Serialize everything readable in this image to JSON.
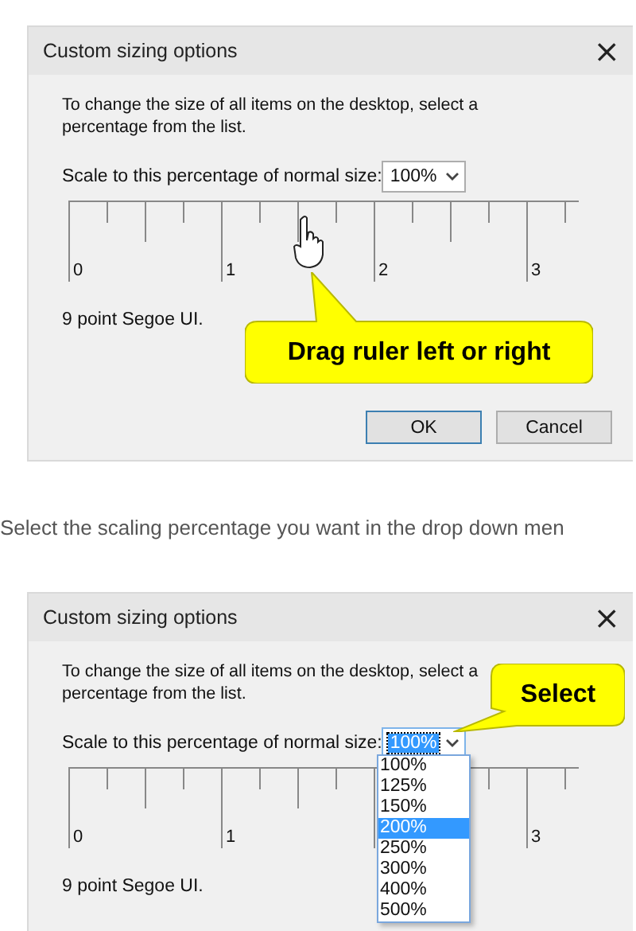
{
  "dialogs": [
    {
      "title": "Custom sizing options",
      "close": "×",
      "description": "To change the size of all items on the desktop, select a percentage from the list.",
      "scale_label": "Scale to this percentage of normal size:",
      "scale_value": "100%",
      "scale_focused": false,
      "ruler_labels": [
        "0",
        "1",
        "2",
        "3"
      ],
      "font_note": "9 point Segoe UI.",
      "callout": {
        "kind": "ruler",
        "text": "Drag ruler left or right"
      },
      "buttons": [
        {
          "label": "OK",
          "default": true
        },
        {
          "label": "Cancel",
          "default": false
        }
      ]
    },
    {
      "title": "Custom sizing options",
      "close": "×",
      "description": "To change the size of all items on the desktop, select a percentage from the list.",
      "scale_label": "Scale to this percentage of normal size:",
      "scale_value": "100%",
      "scale_focused": true,
      "ruler_labels": [
        "0",
        "1",
        "3"
      ],
      "font_note": "9 point Segoe UI.",
      "callout": {
        "kind": "select",
        "text": "Select"
      },
      "dropdown_options": [
        {
          "label": "100%",
          "selected": false
        },
        {
          "label": "125%",
          "selected": false
        },
        {
          "label": "150%",
          "selected": false
        },
        {
          "label": "200%",
          "selected": true
        },
        {
          "label": "250%",
          "selected": false
        },
        {
          "label": "300%",
          "selected": false
        },
        {
          "label": "400%",
          "selected": false
        },
        {
          "label": "500%",
          "selected": false
        }
      ]
    }
  ],
  "caption": "Select the scaling percentage you want in the drop down men"
}
